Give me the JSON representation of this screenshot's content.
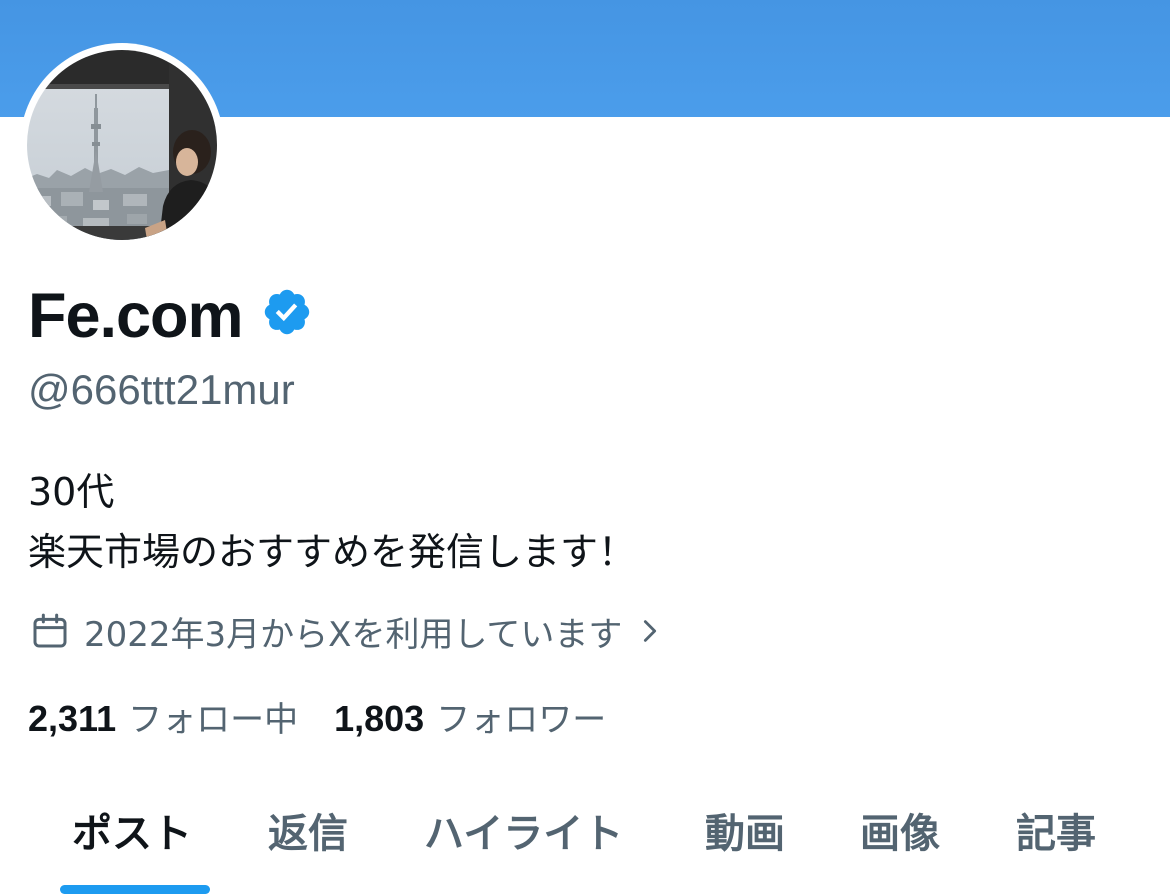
{
  "profile": {
    "display_name": "Fe.com",
    "handle": "@666ttt21mur",
    "verified": true,
    "bio_lines": [
      "30代",
      "楽天市場のおすすめを発信します！"
    ],
    "joined": "2022年3月からXを利用しています"
  },
  "stats": {
    "following_count": "2,311",
    "following_label": "フォロー中",
    "followers_count": "1,803",
    "followers_label": "フォロワー"
  },
  "tabs": [
    {
      "label": "ポスト",
      "active": true
    },
    {
      "label": "返信",
      "active": false
    },
    {
      "label": "ハイライト",
      "active": false
    },
    {
      "label": "動画",
      "active": false
    },
    {
      "label": "画像",
      "active": false
    },
    {
      "label": "記事",
      "active": false
    }
  ],
  "icons": {
    "verified": "verified-badge-icon",
    "joined": "calendar-icon",
    "joined_more": "chevron-right-icon"
  },
  "colors": {
    "banner": "#4a9ae8",
    "accent": "#1d9bf0",
    "text_primary": "#0f1419",
    "text_secondary": "#536471"
  }
}
